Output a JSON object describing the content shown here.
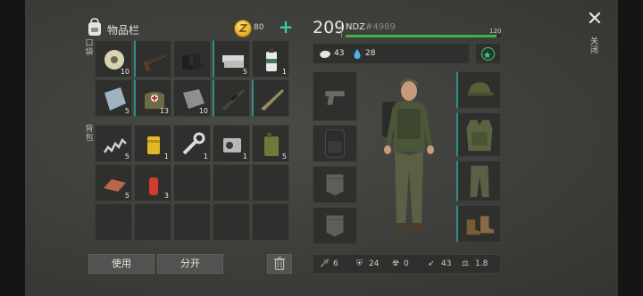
{
  "inventory": {
    "title": "物品栏",
    "coins": "80",
    "pockets_label": "口袋",
    "backpack_label": "背包",
    "pockets": [
      {
        "name": "rope-spool",
        "count": "10"
      },
      {
        "name": "assault-rifle",
        "count": ""
      },
      {
        "name": "boots",
        "count": ""
      },
      {
        "name": "metal-plates",
        "count": "5"
      },
      {
        "name": "spray-can",
        "count": "1"
      },
      {
        "name": "glass-shard",
        "count": "5"
      },
      {
        "name": "medkit-bag",
        "count": "13"
      },
      {
        "name": "metal-sheet",
        "count": "10"
      },
      {
        "name": "sniper-rifle",
        "count": ""
      },
      {
        "name": "tan-rifle",
        "count": ""
      }
    ],
    "backpack": [
      {
        "name": "spring",
        "count": "5"
      },
      {
        "name": "oil-filter",
        "count": "1"
      },
      {
        "name": "wrench",
        "count": "1"
      },
      {
        "name": "engine-part",
        "count": "1"
      },
      {
        "name": "fuel-can",
        "count": "5"
      },
      {
        "name": "copper-bar",
        "count": "5"
      },
      {
        "name": "fire-extinguisher",
        "count": "3"
      },
      {
        "name": "",
        "count": ""
      },
      {
        "name": "",
        "count": ""
      },
      {
        "name": "",
        "count": ""
      },
      {
        "name": "",
        "count": ""
      },
      {
        "name": "",
        "count": ""
      },
      {
        "name": "",
        "count": ""
      },
      {
        "name": "",
        "count": ""
      },
      {
        "name": "",
        "count": ""
      }
    ],
    "use_label": "使用",
    "split_label": "分开"
  },
  "player": {
    "level": "209",
    "name": "NDZ",
    "tag": "#4989",
    "xp_max": "120",
    "xp_fraction": 0.97,
    "food": "43",
    "water": "28"
  },
  "stats": {
    "attack": "6",
    "defense": "24",
    "radiation": "0",
    "speed": "43",
    "weight": "1.8"
  },
  "close_label": "关闭",
  "colors": {
    "accent": "#3fc9a6",
    "xp": "#3db54f",
    "durability": "#2f9a86"
  }
}
